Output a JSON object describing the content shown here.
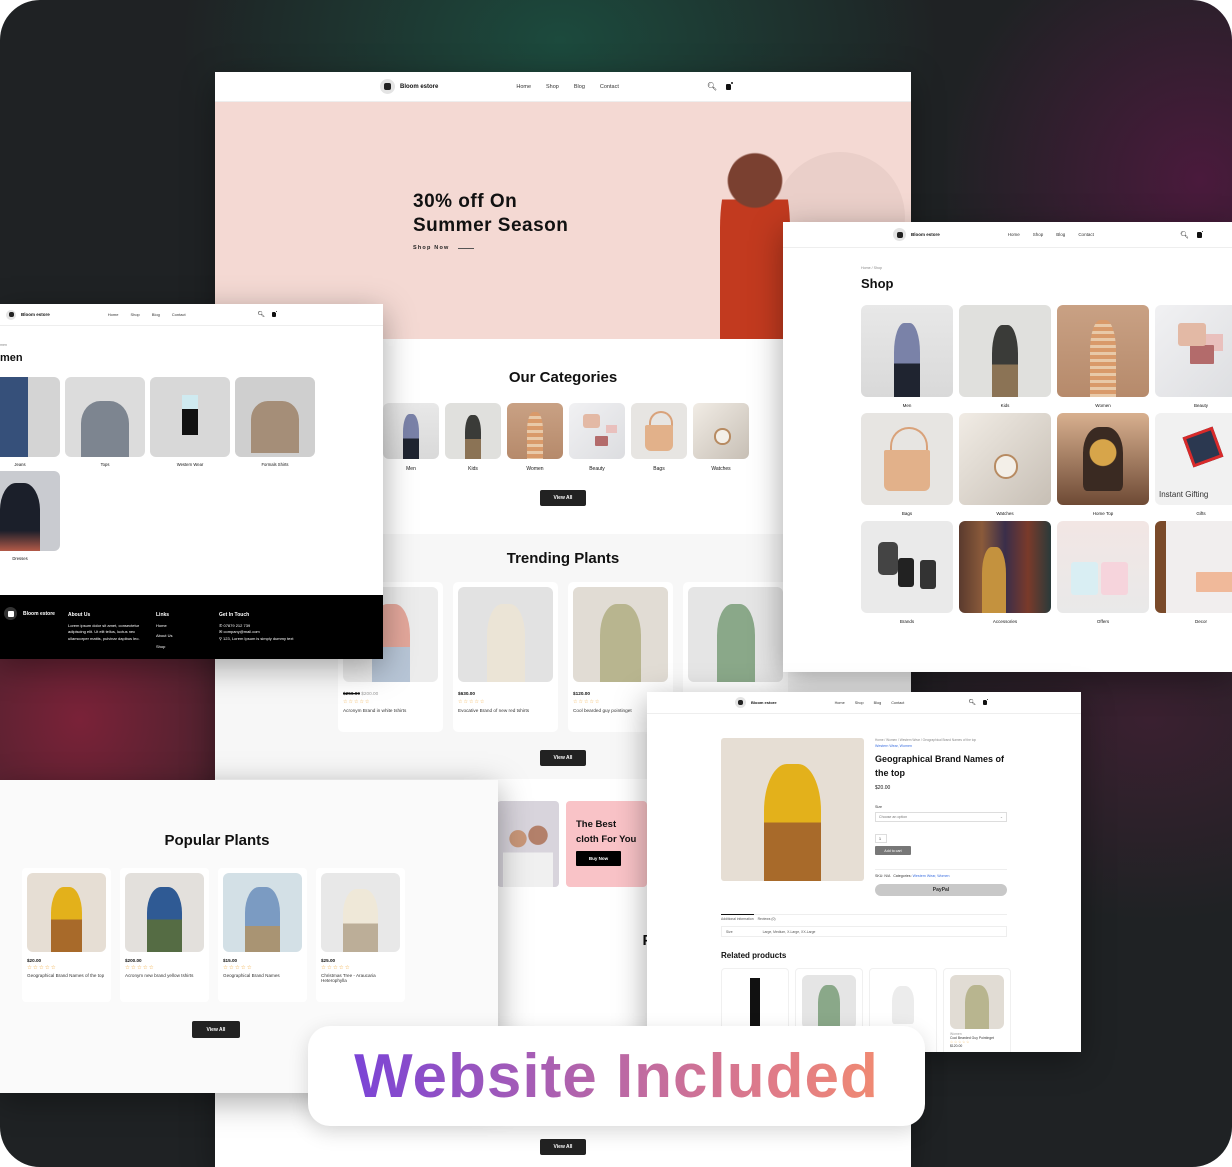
{
  "brand": {
    "name": "Bloom estore"
  },
  "nav": {
    "items": [
      "Home",
      "Shop",
      "Blog",
      "Contact"
    ],
    "cart_count": "0"
  },
  "icons": {
    "search": "search-icon",
    "cart": "cart-icon",
    "user": "user-icon",
    "logo": "shopping-bag-icon"
  },
  "colors": {
    "hero_bg": "#f4d9d3",
    "dark_button": "#222222",
    "star": "#f0a93b",
    "link": "#3a6ee0",
    "badge_gradient": [
      "#7b44d6",
      "#b465aa",
      "#e07b88",
      "#f08a72"
    ],
    "promo_pink": "#f9c3c7"
  },
  "home": {
    "hero": {
      "headline_line1": "30% off On",
      "headline_line2": "Summer Season",
      "cta": "Shop Now"
    },
    "categories": {
      "title": "Our Categories",
      "items": [
        "Men",
        "Kids",
        "Women",
        "Beauty",
        "Bags",
        "Watches"
      ],
      "view_all": "View All"
    },
    "trending": {
      "title": "Trending Plants",
      "products": [
        {
          "old_price": "$250.00",
          "price": "$200.00",
          "name": "Acronym Brand in white tshirts"
        },
        {
          "price": "$630.00",
          "name": "Evocative Brand of new red tshirts"
        },
        {
          "price": "$120.00",
          "name": "Cool bearded guy pointinget"
        },
        {
          "price": "",
          "name": ""
        }
      ],
      "view_all": "View All"
    },
    "promo": {
      "title": "The Best cloth For You",
      "button": "Buy Now"
    },
    "popular_title": "Popular Plants",
    "bottom_view_all": "View All"
  },
  "women_page": {
    "breadcrumb": "men",
    "title": "men",
    "categories": [
      "Jeans",
      "Tops",
      "Western Wear",
      "Formals Shirts",
      "Dresses"
    ],
    "footer": {
      "about_title": "About Us",
      "about_text": "Lorem ipsum dolor sit amet, consectetur adipiscing elit. Ut elit tellus, luctus nec ullamcorper mattis, pulvinar dapibus leo.",
      "links_title": "Links",
      "links": [
        "Home",
        "About Us",
        "Shop"
      ],
      "contact_title": "Get In Touch",
      "phone": "07879 212 739",
      "email": "company@mail.com",
      "address": "123, Lorem Ipsum is simply dummy text"
    }
  },
  "shop_page": {
    "breadcrumb": "Home / Shop",
    "title": "Shop",
    "categories": [
      "Men",
      "Kids",
      "Women",
      "Beauty",
      "Bags",
      "Watches",
      "Home Top",
      "Gifts",
      "Brands",
      "Accessories",
      "Offers",
      "Decor"
    ],
    "gift_overlay": "Instant Gifting"
  },
  "product_page": {
    "breadcrumb": "Home / Women / Western Wear / Geographical Brand Names of the top",
    "category_link": "Western Wear, Women",
    "title": "Geographical Brand Names of the top",
    "price": "$20.00",
    "size_label": "Size",
    "size_placeholder": "Choose an option",
    "quantity": "1",
    "add_to_cart": "Add to cart",
    "sku_label": "SKU: N/A",
    "categories_label": "Categories:",
    "categories_value": "Western Wear, Women",
    "paypal_label": "PayPal",
    "tabs": [
      "Additional information",
      "Reviews (0)"
    ],
    "info_key": "Size",
    "info_value": "Large, Medium, X-Large, XX-Large",
    "related_title": "Related products",
    "related": [
      {
        "category": "",
        "name": "",
        "price": ""
      },
      {
        "category": "",
        "name": "",
        "price": ""
      },
      {
        "category": "",
        "name": "",
        "price": ""
      },
      {
        "category": "Women",
        "name": "Cool Bearded Guy Pointinget",
        "price": "$120.00"
      }
    ]
  },
  "popular_page": {
    "title": "Popular Plants",
    "products": [
      {
        "price": "$20.00",
        "name": "Geographical Brand Names of the top"
      },
      {
        "price": "$200.00",
        "name": "Acronym new brand yellow tshirts"
      },
      {
        "price": "$15.00",
        "name": "Geographical Brand Names"
      },
      {
        "price": "$25.00",
        "name": "Christmas Tree - Araucaria Heterophylla"
      }
    ],
    "view_all": "View All"
  },
  "badge": {
    "text": "Website Included"
  },
  "stars": "☆☆☆☆☆"
}
